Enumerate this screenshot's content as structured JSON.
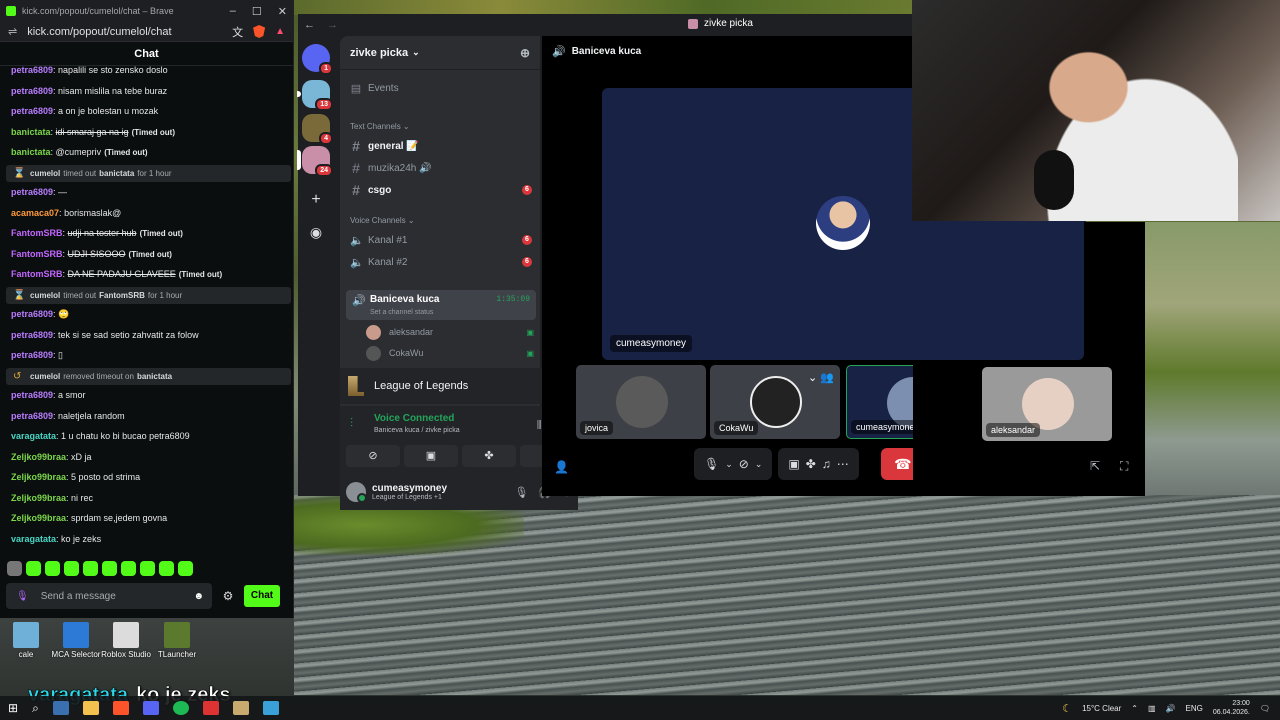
{
  "browser": {
    "window_title": "kick.com/popout/cumelol/chat – Brave",
    "url": "kick.com/popout/cumelol/chat",
    "chat_header": "Chat",
    "send_placeholder": "Send a message",
    "chat_button": "Chat"
  },
  "chat": [
    {
      "user": "petra6809",
      "color": "#b87dff",
      "text": "napalili se sto zensko doslo"
    },
    {
      "user": "petra6809",
      "color": "#b87dff",
      "text": "nisam mislila na tebe buraz"
    },
    {
      "user": "petra6809",
      "color": "#b87dff",
      "text": "a on je bolestan u mozak"
    },
    {
      "user": "banictata",
      "color": "#7bd64a",
      "text": "idi smaraj ga na ig",
      "strike": true,
      "timed": "(Timed out)"
    },
    {
      "user": "banictata",
      "color": "#7bd64a",
      "text": "@cumepriv",
      "timed": "(Timed out)"
    },
    {
      "system": true,
      "icon": "hourglass",
      "actor": "cumelol",
      "action": "timed out",
      "target": "banictata",
      "suffix": "for 1 hour"
    },
    {
      "user": "petra6809",
      "color": "#b87dff",
      "text": "—"
    },
    {
      "user": "acamaca07",
      "color": "#ff9a3d",
      "text": "borismaslak@"
    },
    {
      "user": "FantomSRB",
      "color": "#c266ff",
      "text": "udji na toster hub",
      "strike": true,
      "timed": "(Timed out)"
    },
    {
      "user": "FantomSRB",
      "color": "#c266ff",
      "text": "UDJI SISOOO",
      "strike": true,
      "timed": "(Timed out)"
    },
    {
      "user": "FantomSRB",
      "color": "#c266ff",
      "text": "DA NE PADAJU GLAVEEE",
      "strike": true,
      "timed": "(Timed out)"
    },
    {
      "system": true,
      "icon": "hourglass",
      "actor": "cumelol",
      "action": "timed out",
      "target": "FantomSRB",
      "suffix": "for 1 hour"
    },
    {
      "user": "petra6809",
      "color": "#b87dff",
      "text": "🙄"
    },
    {
      "user": "petra6809",
      "color": "#b87dff",
      "text": "tek si se sad setio zahvatit za folow"
    },
    {
      "user": "petra6809",
      "color": "#b87dff",
      "text": "▯"
    },
    {
      "system": true,
      "icon": "restore",
      "actor": "cumelol",
      "action": "removed timeout on",
      "target": "banictata",
      "suffix": ""
    },
    {
      "user": "petra6809",
      "color": "#b87dff",
      "text": "a smor"
    },
    {
      "user": "petra6809",
      "color": "#b87dff",
      "text": "naletjela random"
    },
    {
      "user": "varagatata",
      "color": "#4ad6c4",
      "text": "1 u chatu ko bi bucao petra6809"
    },
    {
      "user": "Zeljko99braa",
      "color": "#7bd64a",
      "text": "xD ja"
    },
    {
      "user": "Zeljko99braa",
      "color": "#7bd64a",
      "text": "5 posto od strima"
    },
    {
      "user": "Zeljko99braa",
      "color": "#7bd64a",
      "text": "ni rec"
    },
    {
      "user": "Zeljko99braa",
      "color": "#7bd64a",
      "text": "sprdam se,jedem govna"
    },
    {
      "user": "varagatata",
      "color": "#4ad6c4",
      "text": "ko je zeks"
    }
  ],
  "desktop_icons": [
    {
      "label": "cale",
      "color": "#6fb0d9"
    },
    {
      "label": "MCA Selector",
      "color": "#2d7ad6"
    },
    {
      "label": "Roblox Studio",
      "color": "#dcdcdc"
    },
    {
      "label": "TLauncher",
      "color": "#5c7a2e"
    }
  ],
  "caption": {
    "user": "varagatata",
    "text": "ko je zeks"
  },
  "taskbar": {
    "weather": "15°C  Clear",
    "lang": "ENG",
    "time": "23:00",
    "date": "06.04.2026."
  },
  "discord": {
    "window_title": "zivke picka",
    "server_name": "zivke picka",
    "events_label": "Events",
    "text_category": "Text Channels",
    "voice_category": "Voice Channels",
    "text_channels": [
      {
        "name": "general 📝",
        "bright": true,
        "badge": ""
      },
      {
        "name": "muzika24h 🔊",
        "bright": false,
        "badge": ""
      },
      {
        "name": "csgo",
        "bright": true,
        "badge": "6"
      }
    ],
    "voice_channels": [
      {
        "name": "Kanal #1",
        "badge": "6"
      },
      {
        "name": "Kanal #2",
        "badge": "6"
      }
    ],
    "active_vc": {
      "name": "Baniceva kuca",
      "status": "Set a channel status",
      "timer": "1:35:09"
    },
    "vc_users": [
      "aleksandar",
      "CokaWu"
    ],
    "guild_badges": [
      "1",
      "13",
      "4",
      "24"
    ],
    "activity": "League of Legends",
    "voice_connected": "Voice Connected",
    "voice_location": "Baniceva kuca  /  zivke picka",
    "user": {
      "name": "cumeasymoney",
      "sub": "League of Legends +1"
    },
    "stage_title": "Baniceva kuca",
    "main_tile_label": "cumeasymoney",
    "thumbs": [
      {
        "label": "jovica",
        "bg": "#3e4047",
        "av": "#5a5a5a"
      },
      {
        "label": "CokaWu",
        "bg": "#3e4047",
        "av": "#222222"
      },
      {
        "label": "cumeasymoney",
        "bg": "#172245",
        "av": "#7c8fb0"
      },
      {
        "label": "aleksandar",
        "bg": "#9a9a9a",
        "av": "#e6d0c4"
      }
    ]
  }
}
